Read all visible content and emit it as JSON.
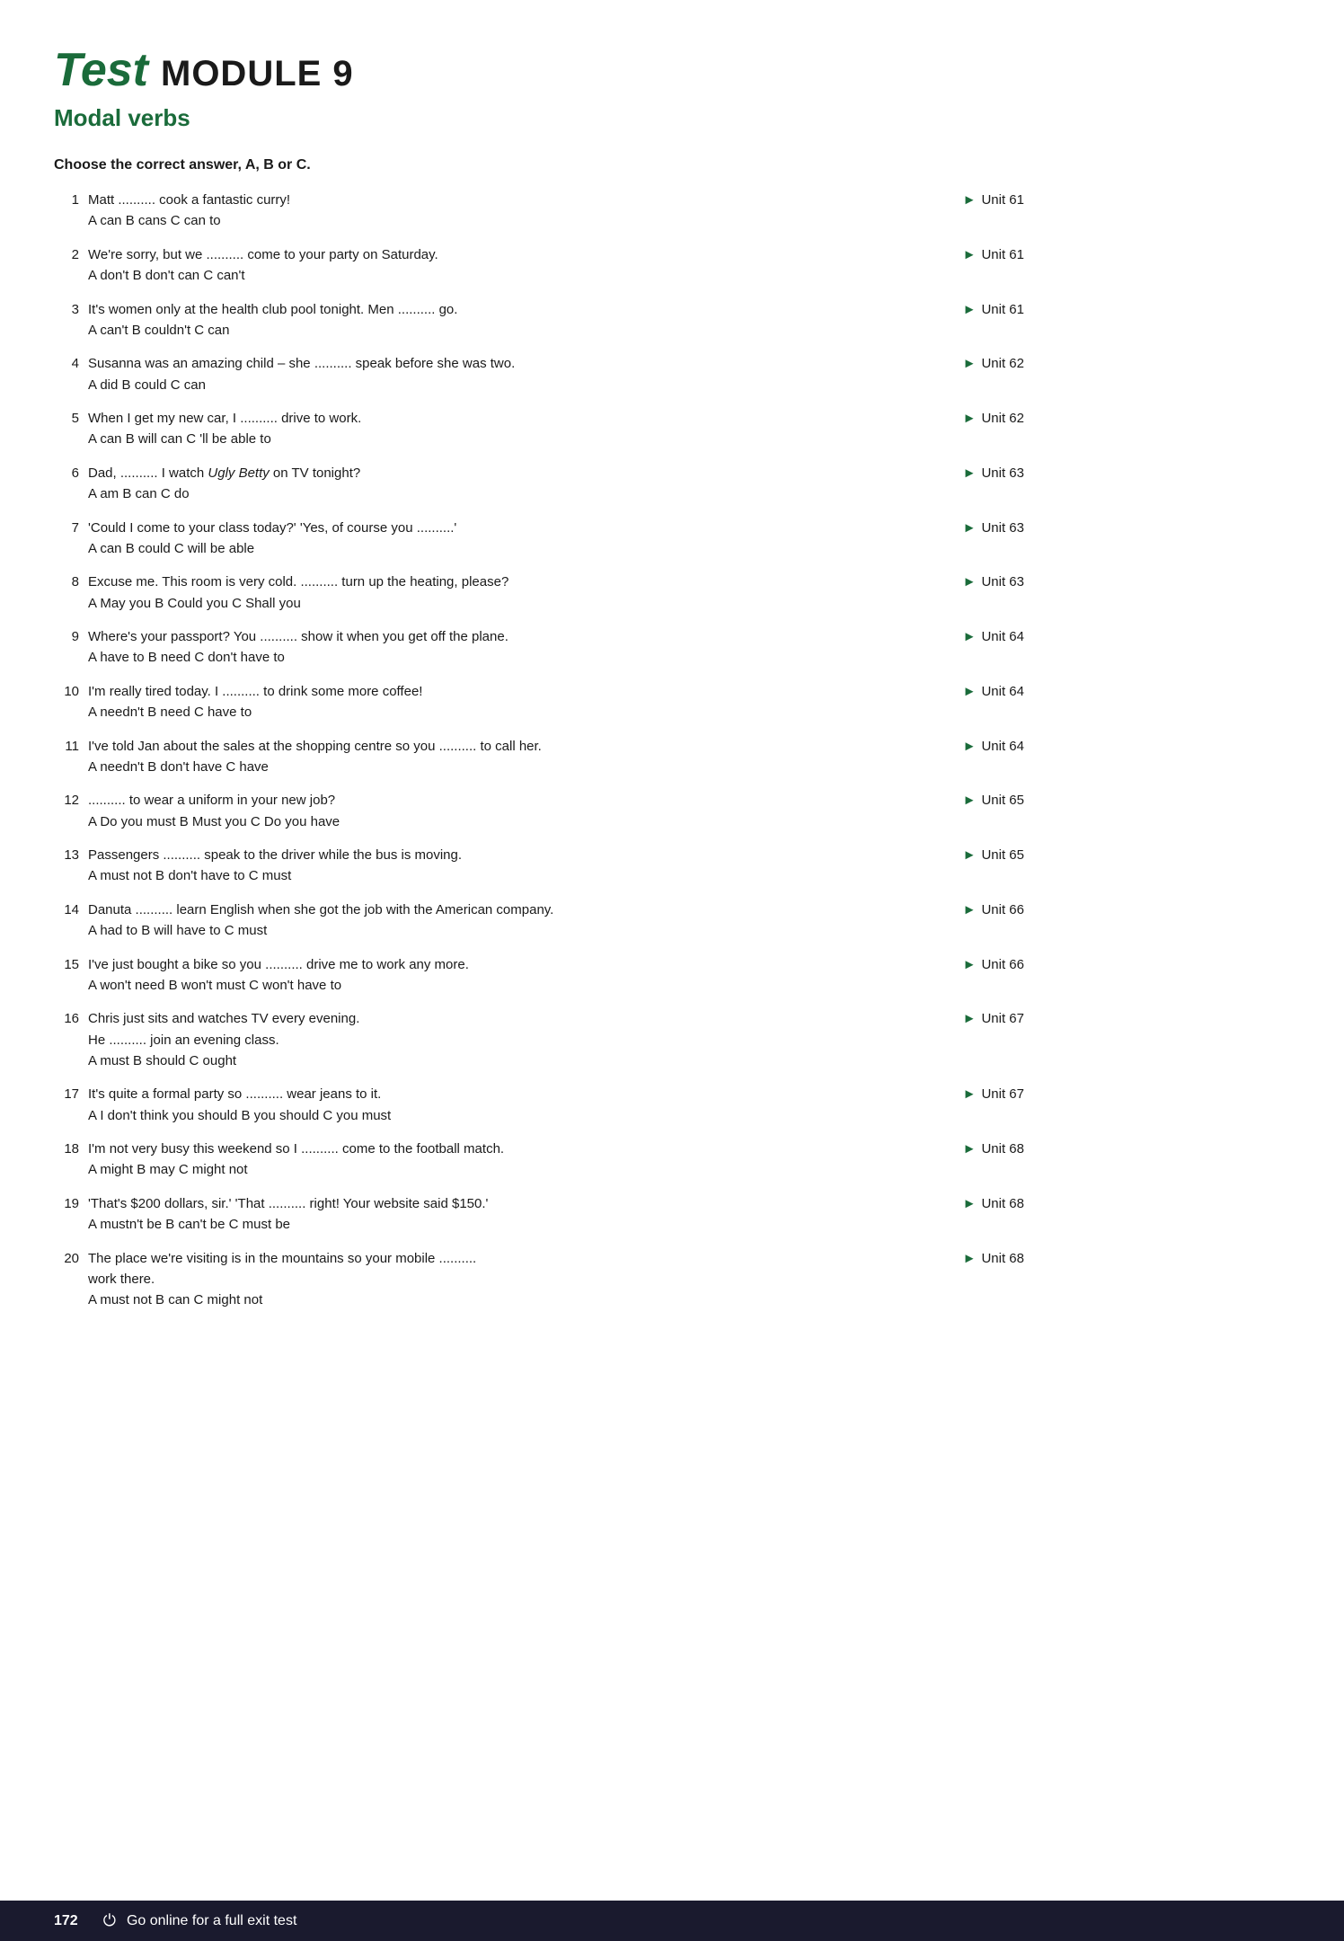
{
  "header": {
    "title_bold": "Test",
    "title_rest": "MODULE 9",
    "subtitle": "Modal verbs"
  },
  "instruction": "Choose the correct answer, A, B or C.",
  "questions": [
    {
      "num": "1",
      "text": "Matt .......... cook a fantastic curry!",
      "answers": "A can  B cans  C can to",
      "unit": "Unit 61"
    },
    {
      "num": "2",
      "text": "We're sorry, but we .......... come to your party on Saturday.",
      "answers": "A don't  B don't can  C can't",
      "unit": "Unit 61"
    },
    {
      "num": "3",
      "text": "It's women only at the health club pool tonight. Men .......... go.",
      "answers": "A can't  B couldn't  C can",
      "unit": "Unit 61"
    },
    {
      "num": "4",
      "text": "Susanna was an amazing child – she .......... speak before she was two.",
      "answers": "A did  B could  C can",
      "unit": "Unit 62"
    },
    {
      "num": "5",
      "text": "When I get my new car, I .......... drive to work.",
      "answers": "A can  B will can  C 'll be able to",
      "unit": "Unit 62"
    },
    {
      "num": "6",
      "text": "Dad, .......... I watch Ugly Betty on TV tonight?",
      "answers": "A am  B can  C do",
      "unit": "Unit 63",
      "italic_word": "Ugly Betty"
    },
    {
      "num": "7",
      "text": "'Could I come to your class today?' 'Yes, of course you ..........'",
      "answers": "A can  B could  C will be able",
      "unit": "Unit 63"
    },
    {
      "num": "8",
      "text": "Excuse me. This room is very cold. .......... turn up the heating, please?",
      "answers": "A May you  B Could you  C Shall you",
      "unit": "Unit 63"
    },
    {
      "num": "9",
      "text": "Where's your passport? You .......... show it when you get off the plane.",
      "answers": "A have to  B need  C don't have to",
      "unit": "Unit 64"
    },
    {
      "num": "10",
      "text": "I'm really tired today. I .......... to drink some more coffee!",
      "answers": "A needn't  B need  C have to",
      "unit": "Unit 64"
    },
    {
      "num": "11",
      "text": "I've told Jan about the sales at the shopping centre so you .......... to call her.",
      "answers": "A needn't  B don't have  C have",
      "unit": "Unit 64"
    },
    {
      "num": "12",
      "text": ".......... to wear a uniform in your new job?",
      "answers": "A Do you must  B Must you  C Do you have",
      "unit": "Unit 65"
    },
    {
      "num": "13",
      "text": "Passengers .......... speak to the driver while the bus is moving.",
      "answers": "A must not  B don't have to  C must",
      "unit": "Unit 65"
    },
    {
      "num": "14",
      "text": "Danuta .......... learn English when she got the job with the American company.",
      "answers": "A had to  B will have to  C must",
      "unit": "Unit 66"
    },
    {
      "num": "15",
      "text": "I've just bought a bike so you .......... drive me to work any more.",
      "answers": "A won't need  B won't must  C won't have to",
      "unit": "Unit 66"
    },
    {
      "num": "16",
      "text": "Chris just sits and watches TV every evening.\nHe .......... join an evening class.",
      "answers": "A must  B should  C ought",
      "unit": "Unit 67"
    },
    {
      "num": "17",
      "text": "It's quite a formal party so .......... wear jeans to it.",
      "answers": "A I don't think you should  B you should  C you must",
      "unit": "Unit 67"
    },
    {
      "num": "18",
      "text": "I'm not very busy this weekend so I .......... come to the football match.",
      "answers": "A might  B may  C might not",
      "unit": "Unit 68"
    },
    {
      "num": "19",
      "text": "'That's $200 dollars, sir.' 'That .......... right! Your website said $150.'",
      "answers": "A mustn't be  B can't be  C must be",
      "unit": "Unit 68"
    },
    {
      "num": "20",
      "text": "The place we're visiting is in the mountains so your mobile ..........\nwork there.",
      "answers": "A must not  B can  C might not",
      "unit": "Unit 68"
    }
  ],
  "footer": {
    "page_number": "172",
    "text": "Go online for a full exit test"
  }
}
